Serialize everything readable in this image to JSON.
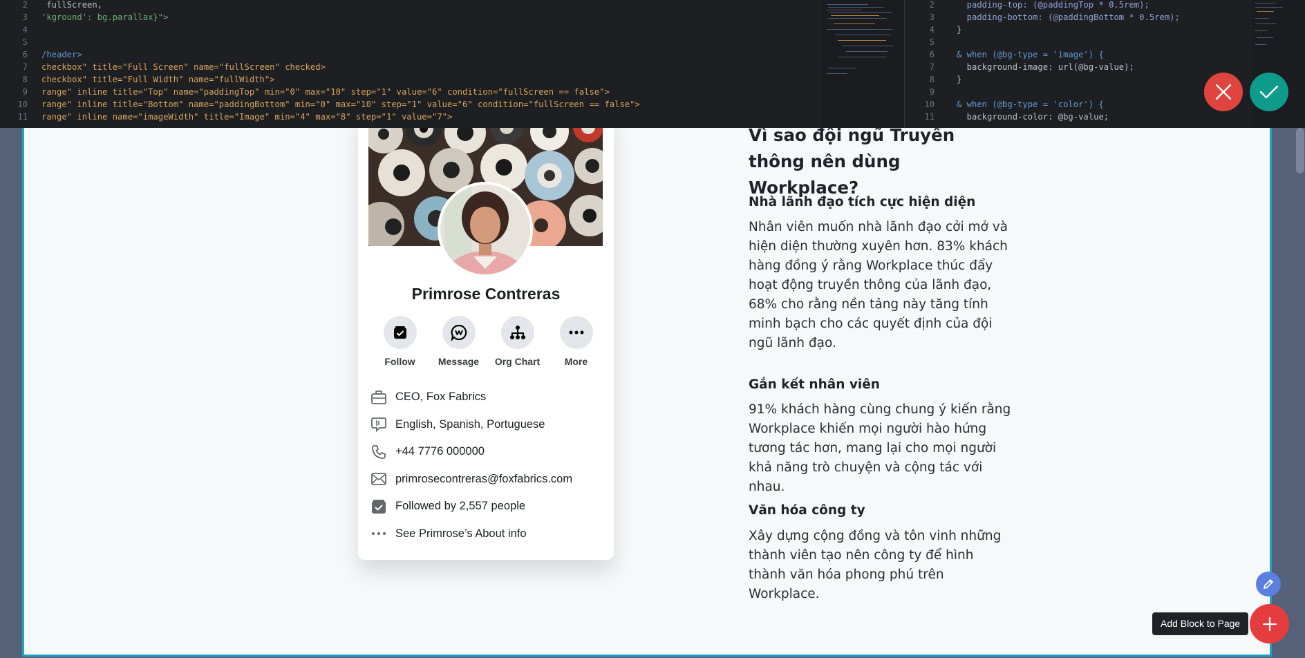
{
  "editor": {
    "left_lines": [
      {
        "num": "2",
        "code": " fullScreen,"
      },
      {
        "num": "3",
        "code": "'kground': bg.parallax}\">"
      },
      {
        "num": "4",
        "code": ""
      },
      {
        "num": "5",
        "code": ""
      },
      {
        "num": "6",
        "code": "/header>"
      },
      {
        "num": "7",
        "code": "checkbox\" title=\"Full Screen\" name=\"fullScreen\" checked>"
      },
      {
        "num": "8",
        "code": "checkbox\" title=\"Full Width\" name=\"fullWidth\">"
      },
      {
        "num": "9",
        "code": "range\" inline title=\"Top\" name=\"paddingTop\" min=\"0\" max=\"10\" step=\"1\" value=\"6\" condition=\"fullScreen == false\">"
      },
      {
        "num": "10",
        "code": "range\" inline title=\"Bottom\" name=\"paddingBottom\" min=\"0\" max=\"10\" step=\"1\" value=\"6\" condition=\"fullScreen == false\">"
      },
      {
        "num": "11",
        "code": "range\" inline name=\"imageWidth\" title=\"Image\" min=\"4\" max=\"8\" step=\"1\" value=\"7\">"
      }
    ],
    "right_lines": [
      {
        "num": "2",
        "code": "  padding-top: (@paddingTop * 0.5rem);"
      },
      {
        "num": "3",
        "code": "  padding-bottom: (@paddingBottom * 0.5rem);"
      },
      {
        "num": "4",
        "code": "}"
      },
      {
        "num": "5",
        "code": ""
      },
      {
        "num": "6",
        "code": "& when (@bg-type = 'image') {"
      },
      {
        "num": "7",
        "code": "  background-image: url(@bg-value);"
      },
      {
        "num": "8",
        "code": "}"
      },
      {
        "num": "9",
        "code": ""
      },
      {
        "num": "10",
        "code": "& when (@bg-type = 'color') {"
      },
      {
        "num": "11",
        "code": "  background-color: @bg-value;"
      }
    ]
  },
  "profile": {
    "name": "Primrose Contreras",
    "actions": [
      {
        "label": "Follow",
        "icon": "follow-icon"
      },
      {
        "label": "Message",
        "icon": "message-icon"
      },
      {
        "label": "Org Chart",
        "icon": "org-chart-icon"
      },
      {
        "label": "More",
        "icon": "more-icon"
      }
    ],
    "details": [
      {
        "text": "CEO, Fox Fabrics",
        "icon": "briefcase-icon"
      },
      {
        "text": "English, Spanish, Portuguese",
        "icon": "language-icon"
      },
      {
        "text": "+44 7776 000000",
        "icon": "phone-icon"
      },
      {
        "text": "primrosecontreras@foxfabrics.com",
        "icon": "email-icon"
      },
      {
        "text": "Followed by 2,557 people",
        "icon": "followers-icon"
      },
      {
        "text": "See Primrose’s About info",
        "icon": "ellipsis-icon"
      }
    ]
  },
  "article": {
    "title": "Vì sao đội ngũ Truyền thông nên dùng Workplace?",
    "sections": [
      {
        "heading": "Nhà lãnh đạo tích cực hiện diện",
        "body": "Nhân viên muốn nhà lãnh đạo cởi mở và hiện diện thường xuyên hơn. 83% khách hàng đồng ý rằng Workplace thúc đẩy hoạt động truyền thông của lãnh đạo, 68% cho rằng nền tảng này tăng tính minh bạch cho các quyết định của đội ngũ lãnh đạo."
      },
      {
        "heading": "Gắn kết nhân viên",
        "body": "91% khách hàng cùng chung ý kiến rằng Workplace khiến mọi người hào hứng tương tác hơn, mang lại cho mọi người khả năng trò chuyện và cộng tác với nhau."
      },
      {
        "heading": "Văn hóa công ty",
        "body": "Xây dựng cộng đồng và tôn vinh những thành viên tạo nên công ty để hình thành văn hóa phong phú trên Workplace."
      }
    ]
  },
  "toolbar": {
    "add_block_tooltip": "Add Block to Page"
  },
  "colors": {
    "cancel": "#e0443e",
    "confirm": "#0f9b8a",
    "canvas_border": "#1ea0c0",
    "add_button": "#e53d3d",
    "edit_button": "#5b7fe0"
  }
}
